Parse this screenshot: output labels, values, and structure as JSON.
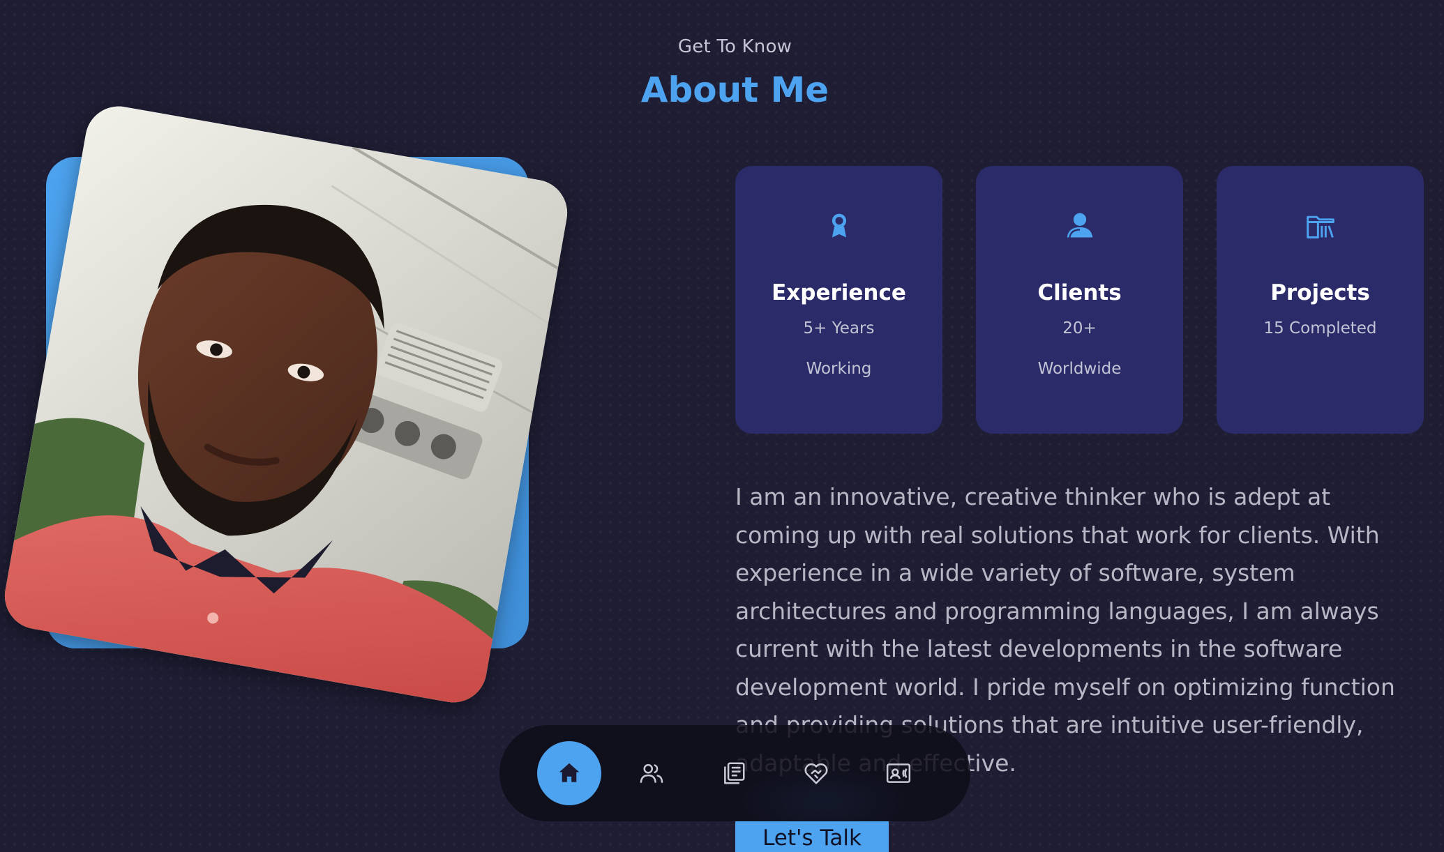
{
  "header": {
    "subtitle": "Get To Know",
    "title": "About Me"
  },
  "portrait": {
    "icon": "profile-photo"
  },
  "stats": [
    {
      "icon": "award-icon",
      "title": "Experience",
      "line1": "5+ Years",
      "line2": "Working"
    },
    {
      "icon": "users-icon",
      "title": "Clients",
      "line1": "20+",
      "line2": "Worldwide"
    },
    {
      "icon": "folder-icon",
      "title": "Projects",
      "line1": "15 Completed",
      "line2": ""
    }
  ],
  "about": {
    "text": "I am an innovative, creative thinker who is adept at coming up with real solutions that work for clients. With experience in a wide variety of software, system architectures and programming languages, I am always current with the latest developments in the software development world. I pride myself on optimizing function and providing solutions that are intuitive user-friendly, adaptable and effective."
  },
  "nav": {
    "items": [
      {
        "icon": "home-icon",
        "active": true
      },
      {
        "icon": "users-icon",
        "active": false
      },
      {
        "icon": "notebook-icon",
        "active": false
      },
      {
        "icon": "heart-handshake-icon",
        "active": false
      },
      {
        "icon": "contact-card-icon",
        "active": false
      }
    ]
  },
  "cta": {
    "label": "Let's Talk"
  },
  "colors": {
    "background": "#1e1d33",
    "accent": "#4da3ef",
    "card": "#2b2b69",
    "text_muted": "#b7b7c6"
  }
}
